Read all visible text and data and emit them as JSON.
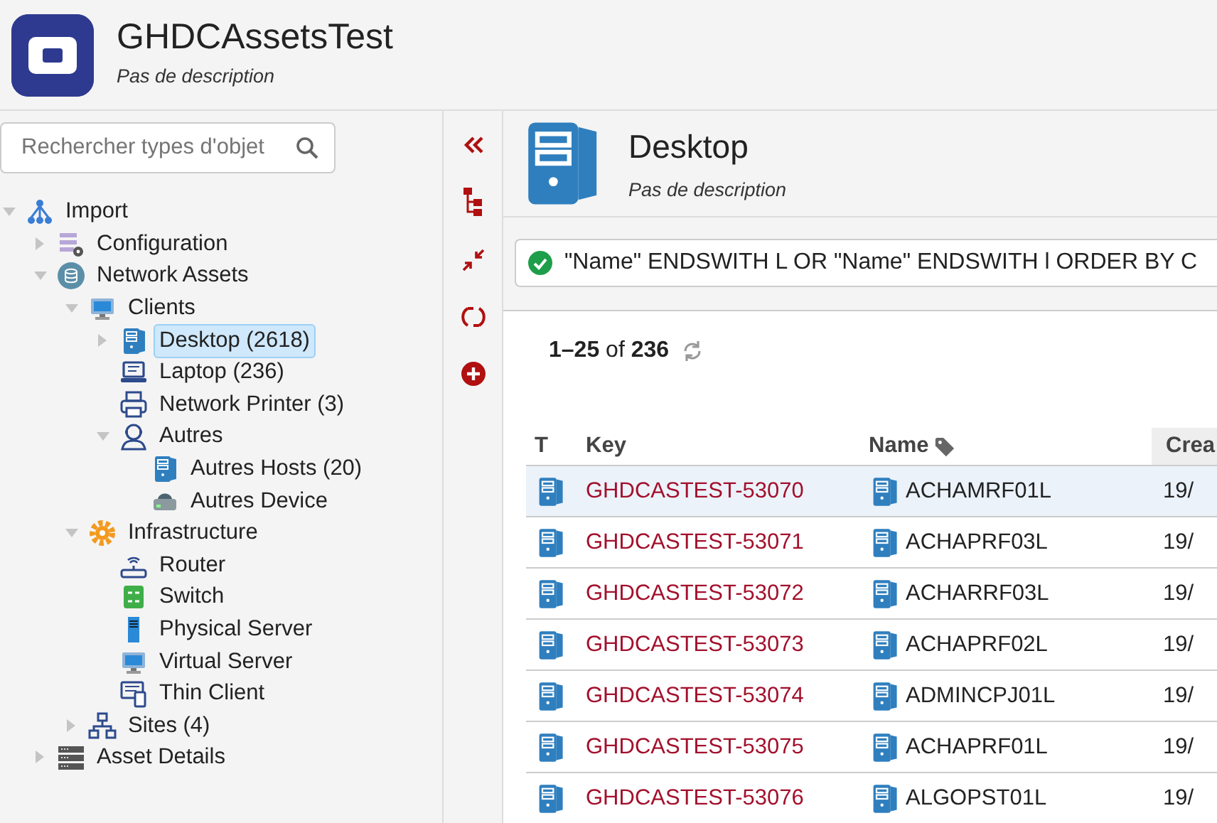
{
  "app": {
    "title": "GHDCAssetsTest",
    "description": "Pas de description"
  },
  "sidebar": {
    "search": {
      "placeholder": "Rechercher types d'objet"
    },
    "tree": [
      {
        "label": "Import",
        "kind": "hierarchy",
        "expanded": true,
        "selected": false,
        "children": [
          {
            "label": "Configuration",
            "kind": "config",
            "expanded": false,
            "selected": false
          },
          {
            "label": "Network Assets",
            "kind": "database",
            "expanded": true,
            "selected": false,
            "children": [
              {
                "label": "Clients",
                "kind": "monitor",
                "expanded": true,
                "selected": false,
                "children": [
                  {
                    "label": "Desktop (2618)",
                    "kind": "desktop",
                    "expanded": false,
                    "selected": true
                  },
                  {
                    "label": "Laptop (236)",
                    "kind": "laptop",
                    "selected": false
                  },
                  {
                    "label": "Network Printer (3)",
                    "kind": "printer",
                    "selected": false
                  },
                  {
                    "label": "Autres",
                    "kind": "user",
                    "expanded": true,
                    "selected": false,
                    "children": [
                      {
                        "label": "Autres Hosts (20)",
                        "kind": "desktop",
                        "selected": false
                      },
                      {
                        "label": "Autres Device",
                        "kind": "device",
                        "selected": false
                      }
                    ]
                  }
                ]
              },
              {
                "label": "Infrastructure",
                "kind": "gear",
                "expanded": true,
                "selected": false,
                "children": [
                  {
                    "label": "Router",
                    "kind": "router",
                    "selected": false
                  },
                  {
                    "label": "Switch",
                    "kind": "switch",
                    "selected": false
                  },
                  {
                    "label": "Physical Server",
                    "kind": "server",
                    "selected": false
                  },
                  {
                    "label": "Virtual Server",
                    "kind": "monitor",
                    "selected": false
                  },
                  {
                    "label": "Thin Client",
                    "kind": "thin",
                    "selected": false
                  }
                ]
              },
              {
                "label": "Sites (4)",
                "kind": "network",
                "expanded": false,
                "selected": false
              }
            ]
          },
          {
            "label": "Asset Details",
            "kind": "rack",
            "expanded": false,
            "selected": false
          }
        ]
      }
    ]
  },
  "object_type": {
    "title": "Desktop",
    "description": "Pas de description"
  },
  "query": {
    "text": "\"Name\" ENDSWITH L OR \"Name\" ENDSWITH l ORDER BY C",
    "valid": true
  },
  "results": {
    "count": "**1–25** of **236**"
  },
  "table": {
    "columns": [
      "T",
      "Key",
      "Name",
      "Crea"
    ],
    "rows": [
      {
        "key": "GHDCASTEST-53070",
        "name": "ACHAMRF01L",
        "created": "19/",
        "selected": true
      },
      {
        "key": "GHDCASTEST-53071",
        "name": "ACHAPRF03L",
        "created": "19/",
        "selected": false
      },
      {
        "key": "GHDCASTEST-53072",
        "name": "ACHARRF03L",
        "created": "19/",
        "selected": false
      },
      {
        "key": "GHDCASTEST-53073",
        "name": "ACHAPRF02L",
        "created": "19/",
        "selected": false
      },
      {
        "key": "GHDCASTEST-53074",
        "name": "ADMINCPJ01L",
        "created": "19/",
        "selected": false
      },
      {
        "key": "GHDCASTEST-53075",
        "name": "ACHAPRF01L",
        "created": "19/",
        "selected": false
      },
      {
        "key": "GHDCASTEST-53076",
        "name": "ALGOPST01L",
        "created": "19/",
        "selected": false
      }
    ]
  }
}
